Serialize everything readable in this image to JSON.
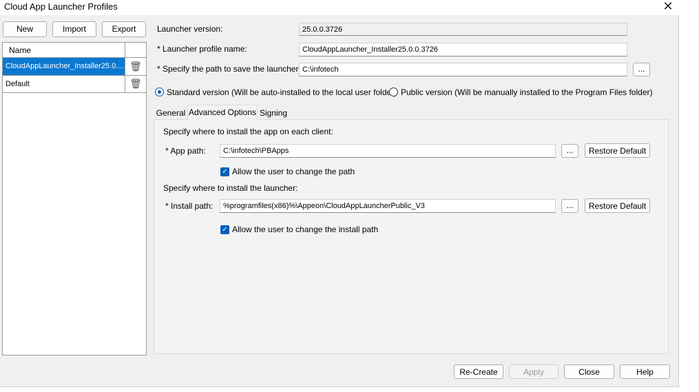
{
  "window": {
    "title": "Cloud App Launcher Profiles",
    "close_glyph": "✕"
  },
  "toolbar": {
    "new_label": "New",
    "import_label": "Import",
    "export_label": "Export"
  },
  "profile_list": {
    "column_header": "Name",
    "items": [
      {
        "name": "CloudAppLauncher_Installer25.0....",
        "selected": true
      },
      {
        "name": "Default",
        "selected": false
      }
    ]
  },
  "form": {
    "launcher_version_label": "Launcher version:",
    "launcher_version_value": "25.0.0.3726",
    "profile_name_label": "* Launcher profile name:",
    "profile_name_value": "CloudAppLauncher_Installer25.0.0.3726",
    "save_path_label": "* Specify the path to save the launcher:",
    "save_path_value": "C:\\infotech",
    "browse_label": "...",
    "standard_version_label": "Standard version (Will be auto-installed to the local user folder)",
    "public_version_label": "Public version (Will be manually installed to the Program Files folder)"
  },
  "tabs": [
    {
      "label": "General",
      "active": false
    },
    {
      "label": "Advanced Options",
      "active": true
    },
    {
      "label": "Signing",
      "active": false
    }
  ],
  "advanced": {
    "app_section_label": "Specify where to install the app on each client:",
    "app_path_label": "* App path:",
    "app_path_value": "C:\\infotech\\PBApps",
    "app_browse_label": "...",
    "app_restore_label": "Restore Default",
    "app_allow_change_label": "Allow the user to change the path",
    "app_allow_change_checked": true,
    "launcher_section_label": "Specify where to install the launcher:",
    "install_path_label": "* Install path:",
    "install_path_value": "%programfiles(x86)%\\Appeon\\CloudAppLauncherPublic_V3",
    "install_browse_label": "...",
    "install_restore_label": "Restore Default",
    "install_allow_change_label": "Allow the user to change the install path",
    "install_allow_change_checked": true,
    "check_glyph": "✓"
  },
  "footer": {
    "recreate_label": "Re-Create",
    "apply_label": "Apply",
    "close_label": "Close",
    "help_label": "Help"
  },
  "icons": {
    "trash": "🗑"
  }
}
